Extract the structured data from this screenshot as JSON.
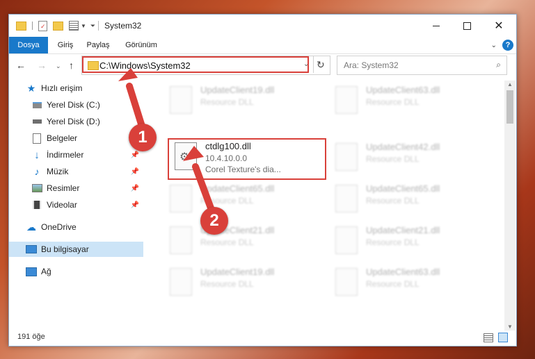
{
  "window": {
    "title": "System32"
  },
  "ribbon": {
    "tabs": [
      "Dosya",
      "Giriş",
      "Paylaş",
      "Görünüm"
    ]
  },
  "address": {
    "path": "C:\\Windows\\System32"
  },
  "search": {
    "placeholder": "Ara: System32"
  },
  "sidebar": {
    "items": [
      {
        "label": "Hızlı erişim",
        "icon": "star-icon"
      },
      {
        "label": "Yerel Disk (C:)",
        "icon": "drive-icon"
      },
      {
        "label": "Yerel Disk (D:)",
        "icon": "drive-icon"
      },
      {
        "label": "Belgeler",
        "icon": "documents-icon"
      },
      {
        "label": "İndirmeler",
        "icon": "download-icon"
      },
      {
        "label": "Müzik",
        "icon": "music-icon"
      },
      {
        "label": "Resimler",
        "icon": "pictures-icon"
      },
      {
        "label": "Videolar",
        "icon": "videos-icon"
      },
      {
        "label": "OneDrive",
        "icon": "cloud-icon"
      },
      {
        "label": "Bu bilgisayar",
        "icon": "computer-icon"
      },
      {
        "label": "Ağ",
        "icon": "network-icon"
      }
    ]
  },
  "files": [
    {
      "name": "UpdateClient19.dll",
      "line2": "Resource DLL",
      "line3": ""
    },
    {
      "name": "UpdateClient63.dll",
      "line2": "Resource DLL",
      "line3": ""
    },
    {
      "name": "ctdlg100.dll",
      "line2": "10.4.10.0.0",
      "line3": "Corel Texture's dia..."
    },
    {
      "name": "UpdateClient42.dll",
      "line2": "Resource DLL",
      "line3": ""
    },
    {
      "name": "UpdateClient65.dll",
      "line2": "Resource DLL",
      "line3": ""
    },
    {
      "name": "UpdateClient65.dll",
      "line2": "Resource DLL",
      "line3": ""
    },
    {
      "name": "UpdateClient21.dll",
      "line2": "Resource DLL",
      "line3": ""
    },
    {
      "name": "UpdateClient21.dll",
      "line2": "Resource DLL",
      "line3": ""
    },
    {
      "name": "UpdateClient19.dll",
      "line2": "Resource DLL",
      "line3": ""
    },
    {
      "name": "UpdateClient63.dll",
      "line2": "Resource DLL",
      "line3": ""
    }
  ],
  "status": {
    "count": "191 öğe"
  },
  "annotations": [
    "1",
    "2"
  ],
  "colors": {
    "accent": "#1979ca",
    "highlight": "#d9403a",
    "selected": "#cce4f7"
  }
}
